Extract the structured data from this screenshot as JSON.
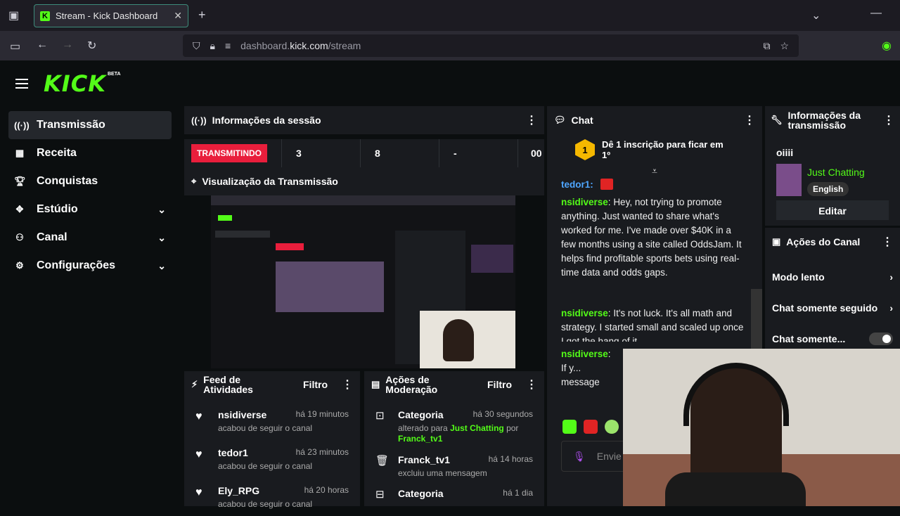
{
  "browser": {
    "tab_title": "Stream - Kick Dashboard",
    "url_prefix": "dashboard.",
    "url_domain": "kick.com",
    "url_path": "/stream"
  },
  "brand": {
    "logo": "KICK",
    "beta": "BETA",
    "accent": "#53fc18"
  },
  "sidebar": {
    "items": [
      {
        "label": "Transmissão",
        "icon": "broadcast-icon"
      },
      {
        "label": "Receita",
        "icon": "revenue-icon"
      },
      {
        "label": "Conquistas",
        "icon": "trophy-icon"
      },
      {
        "label": "Estúdio",
        "icon": "studio-icon"
      },
      {
        "label": "Canal",
        "icon": "channel-icon"
      },
      {
        "label": "Configurações",
        "icon": "gear-icon"
      }
    ]
  },
  "session": {
    "title": "Informações da sessão",
    "status": "TRANSMITINDO",
    "stats": [
      "3",
      "8",
      "-",
      "00"
    ]
  },
  "preview": {
    "title": "Visualização da Transmissão"
  },
  "feed": {
    "title": "Feed de Atividades",
    "filter": "Filtro",
    "items": [
      {
        "name": "nsidiverse",
        "time": "há 19 minutos",
        "sub": "acabou de seguir o canal"
      },
      {
        "name": "tedor1",
        "time": "há 23 minutos",
        "sub": "acabou de seguir o canal"
      },
      {
        "name": "Ely_RPG",
        "time": "há 20 horas",
        "sub": "acabou de seguir o canal"
      }
    ]
  },
  "moderation": {
    "title": "Ações de Moderação",
    "filter": "Filtro",
    "items": [
      {
        "name": "Categoria",
        "time": "há 30 segundos",
        "sub1": "alterado para ",
        "category": "Just Chatting",
        "sub2": " por",
        "user": "Franck_tv1"
      },
      {
        "name": "Franck_tv1",
        "time": "há 14 horas",
        "sub": "excluiu uma mensagem"
      },
      {
        "name": "Categoria",
        "time": "há 1 dia"
      }
    ]
  },
  "chat": {
    "title": "Chat",
    "pinned": "Dê 1 inscrição para ficar em 1º",
    "pinned_rank": "1",
    "first_user": "tedor1:",
    "messages": [
      {
        "user": "nsidiverse",
        "text": "Hey, not trying to promote anything. Just wanted to share what's worked for me. I've made over $40K in a few months using a site called OddsJam. It helps find profitable sports bets using real-time data and odds gaps."
      },
      {
        "user": "nsidiverse",
        "text": "It's not luck. It's all math and strategy. I started small and scaled up once I got the hang of it."
      },
      {
        "user": "nsidiverse",
        "text": "If y... message me o... and I'll walk yo..."
      }
    ],
    "input_placeholder": "Envie"
  },
  "stream_info": {
    "title": "Informações da transmissão",
    "stream_title": "oiiii",
    "category": "Just Chatting",
    "language": "English",
    "edit_label": "Editar"
  },
  "channel_actions": {
    "title": "Ações do Canal",
    "items": [
      "Modo lento",
      "Chat somente seguidores",
      "Chat somente..."
    ]
  }
}
